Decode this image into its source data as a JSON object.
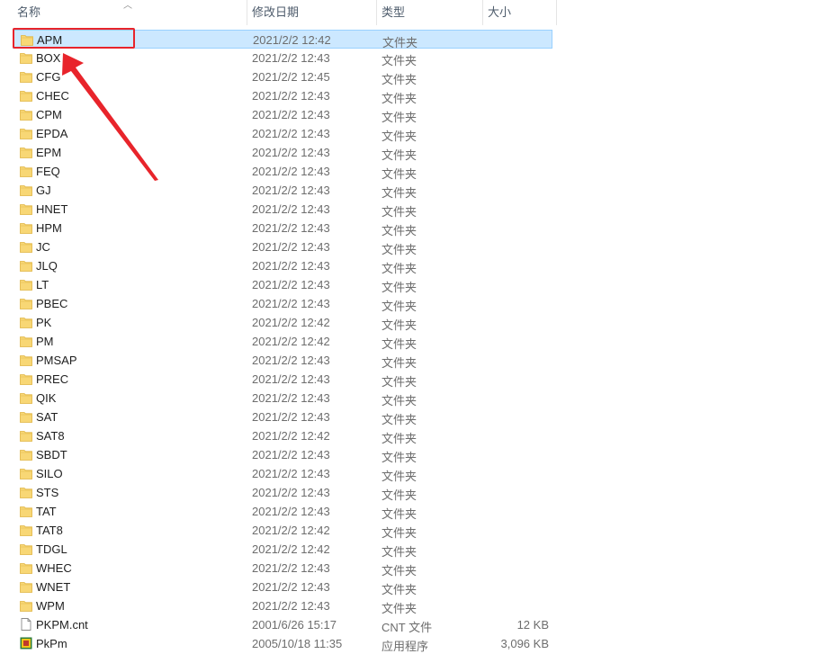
{
  "columns": {
    "name": "名称",
    "date": "修改日期",
    "type": "类型",
    "size": "大小"
  },
  "files": [
    {
      "name": "APM",
      "date": "2021/2/2 12:42",
      "type": "文件夹",
      "size": "",
      "icon": "folder-icon",
      "selected": true
    },
    {
      "name": "BOX",
      "date": "2021/2/2 12:43",
      "type": "文件夹",
      "size": "",
      "icon": "folder-icon"
    },
    {
      "name": "CFG",
      "date": "2021/2/2 12:45",
      "type": "文件夹",
      "size": "",
      "icon": "folder-icon"
    },
    {
      "name": "CHEC",
      "date": "2021/2/2 12:43",
      "type": "文件夹",
      "size": "",
      "icon": "folder-icon"
    },
    {
      "name": "CPM",
      "date": "2021/2/2 12:43",
      "type": "文件夹",
      "size": "",
      "icon": "folder-icon"
    },
    {
      "name": "EPDA",
      "date": "2021/2/2 12:43",
      "type": "文件夹",
      "size": "",
      "icon": "folder-icon"
    },
    {
      "name": "EPM",
      "date": "2021/2/2 12:43",
      "type": "文件夹",
      "size": "",
      "icon": "folder-icon"
    },
    {
      "name": "FEQ",
      "date": "2021/2/2 12:43",
      "type": "文件夹",
      "size": "",
      "icon": "folder-icon"
    },
    {
      "name": "GJ",
      "date": "2021/2/2 12:43",
      "type": "文件夹",
      "size": "",
      "icon": "folder-icon"
    },
    {
      "name": "HNET",
      "date": "2021/2/2 12:43",
      "type": "文件夹",
      "size": "",
      "icon": "folder-icon"
    },
    {
      "name": "HPM",
      "date": "2021/2/2 12:43",
      "type": "文件夹",
      "size": "",
      "icon": "folder-icon"
    },
    {
      "name": "JC",
      "date": "2021/2/2 12:43",
      "type": "文件夹",
      "size": "",
      "icon": "folder-icon"
    },
    {
      "name": "JLQ",
      "date": "2021/2/2 12:43",
      "type": "文件夹",
      "size": "",
      "icon": "folder-icon"
    },
    {
      "name": "LT",
      "date": "2021/2/2 12:43",
      "type": "文件夹",
      "size": "",
      "icon": "folder-icon"
    },
    {
      "name": "PBEC",
      "date": "2021/2/2 12:43",
      "type": "文件夹",
      "size": "",
      "icon": "folder-icon"
    },
    {
      "name": "PK",
      "date": "2021/2/2 12:42",
      "type": "文件夹",
      "size": "",
      "icon": "folder-icon"
    },
    {
      "name": "PM",
      "date": "2021/2/2 12:42",
      "type": "文件夹",
      "size": "",
      "icon": "folder-icon"
    },
    {
      "name": "PMSAP",
      "date": "2021/2/2 12:43",
      "type": "文件夹",
      "size": "",
      "icon": "folder-icon"
    },
    {
      "name": "PREC",
      "date": "2021/2/2 12:43",
      "type": "文件夹",
      "size": "",
      "icon": "folder-icon"
    },
    {
      "name": "QIK",
      "date": "2021/2/2 12:43",
      "type": "文件夹",
      "size": "",
      "icon": "folder-icon"
    },
    {
      "name": "SAT",
      "date": "2021/2/2 12:43",
      "type": "文件夹",
      "size": "",
      "icon": "folder-icon"
    },
    {
      "name": "SAT8",
      "date": "2021/2/2 12:42",
      "type": "文件夹",
      "size": "",
      "icon": "folder-icon"
    },
    {
      "name": "SBDT",
      "date": "2021/2/2 12:43",
      "type": "文件夹",
      "size": "",
      "icon": "folder-icon"
    },
    {
      "name": "SILO",
      "date": "2021/2/2 12:43",
      "type": "文件夹",
      "size": "",
      "icon": "folder-icon"
    },
    {
      "name": "STS",
      "date": "2021/2/2 12:43",
      "type": "文件夹",
      "size": "",
      "icon": "folder-icon"
    },
    {
      "name": "TAT",
      "date": "2021/2/2 12:43",
      "type": "文件夹",
      "size": "",
      "icon": "folder-icon"
    },
    {
      "name": "TAT8",
      "date": "2021/2/2 12:42",
      "type": "文件夹",
      "size": "",
      "icon": "folder-icon"
    },
    {
      "name": "TDGL",
      "date": "2021/2/2 12:42",
      "type": "文件夹",
      "size": "",
      "icon": "folder-icon"
    },
    {
      "name": "WHEC",
      "date": "2021/2/2 12:43",
      "type": "文件夹",
      "size": "",
      "icon": "folder-icon"
    },
    {
      "name": "WNET",
      "date": "2021/2/2 12:43",
      "type": "文件夹",
      "size": "",
      "icon": "folder-icon"
    },
    {
      "name": "WPM",
      "date": "2021/2/2 12:43",
      "type": "文件夹",
      "size": "",
      "icon": "folder-icon"
    },
    {
      "name": "PKPM.cnt",
      "date": "2001/6/26 15:17",
      "type": "CNT 文件",
      "size": "12 KB",
      "icon": "document-icon"
    },
    {
      "name": "PkPm",
      "date": "2005/10/18 11:35",
      "type": "应用程序",
      "size": "3,096 KB",
      "icon": "application-icon"
    }
  ],
  "colors": {
    "selection_bg": "#cce8ff",
    "selection_border": "#99d1ff",
    "annotation": "#e8242b",
    "folder": "#f8d775"
  }
}
